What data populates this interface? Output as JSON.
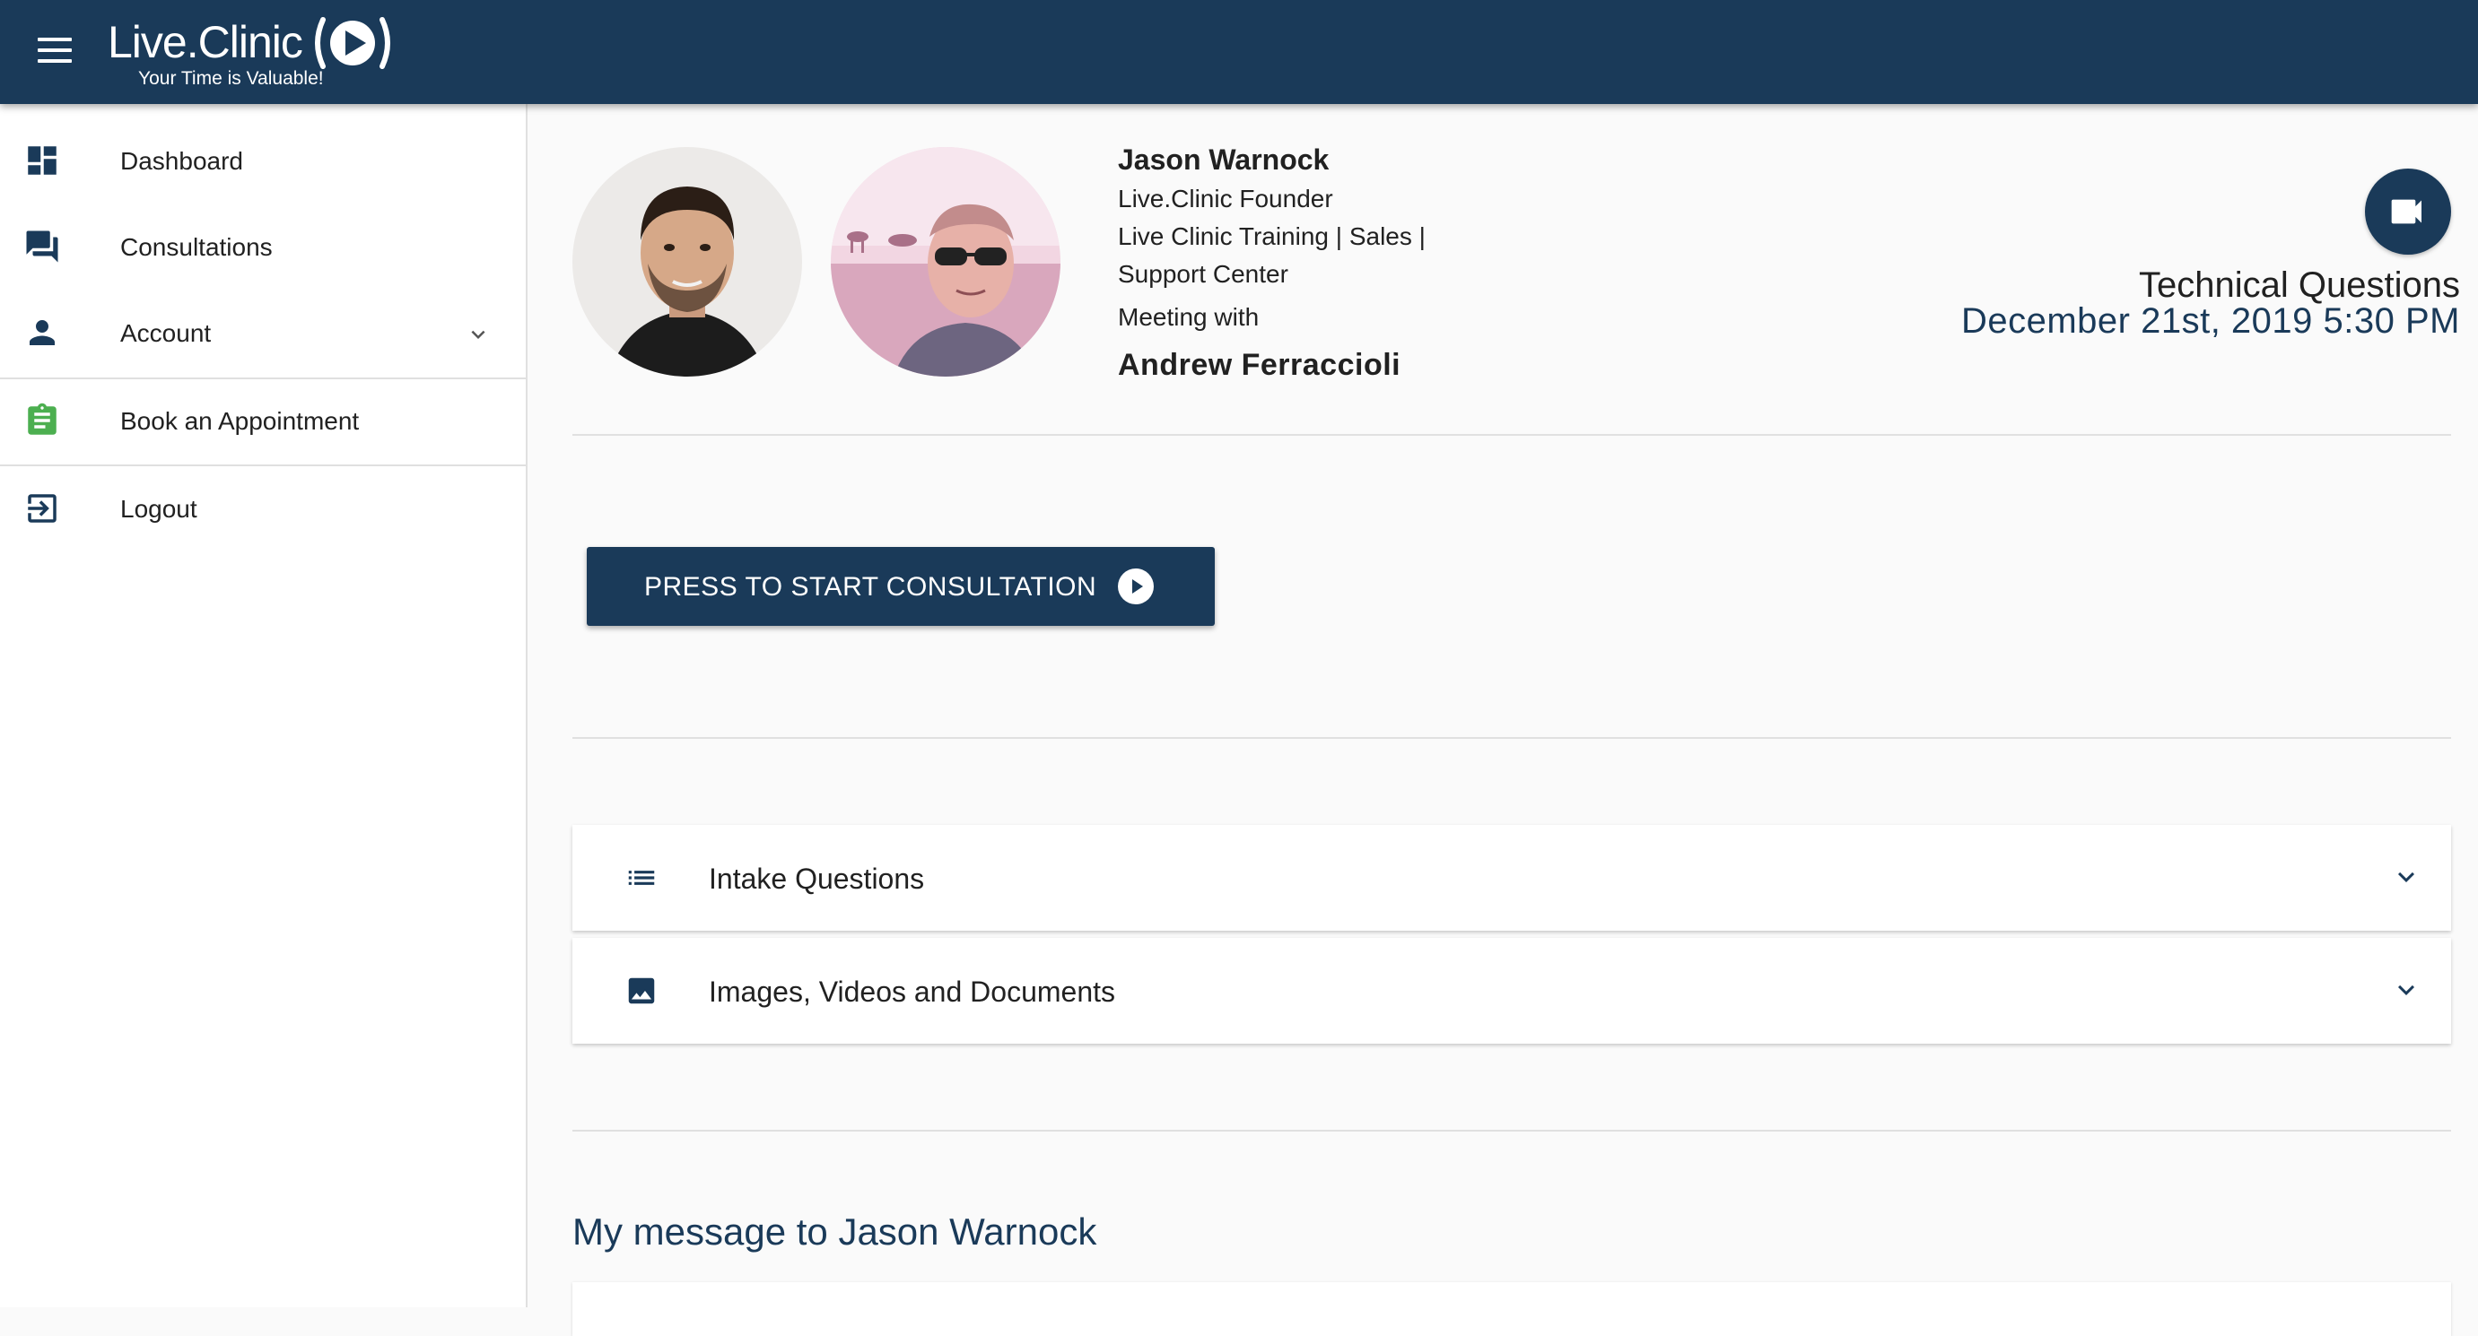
{
  "app": {
    "logo_text": "Live.Clinic",
    "tagline": "Your Time is Valuable!",
    "brand_color": "#1a3a59",
    "accent_green": "#4caf50"
  },
  "sidebar": {
    "items": [
      {
        "label": "Dashboard",
        "icon": "dashboard-icon"
      },
      {
        "label": "Consultations",
        "icon": "forum-icon"
      },
      {
        "label": "Account",
        "icon": "person-icon"
      },
      {
        "label": "Book an Appointment",
        "icon": "clipboard-icon"
      },
      {
        "label": "Logout",
        "icon": "logout-icon"
      }
    ]
  },
  "consultation": {
    "provider_name": "Jason Warnock",
    "provider_title_lines": [
      "Live.Clinic Founder",
      "Live Clinic Training | Sales |",
      "Support Center"
    ],
    "meeting_with_label": "Meeting with",
    "patient_name": "Andrew Ferraccioli",
    "appointment_title": "Technical Questions",
    "appointment_datetime": "December 21st, 2019 5:30 PM",
    "start_button_label": "PRESS TO START CONSULTATION"
  },
  "panels": [
    {
      "label": "Intake Questions",
      "icon": "list-icon"
    },
    {
      "label": "Images, Videos and Documents",
      "icon": "image-icon"
    }
  ],
  "message": {
    "heading": "My message to Jason Warnock"
  }
}
